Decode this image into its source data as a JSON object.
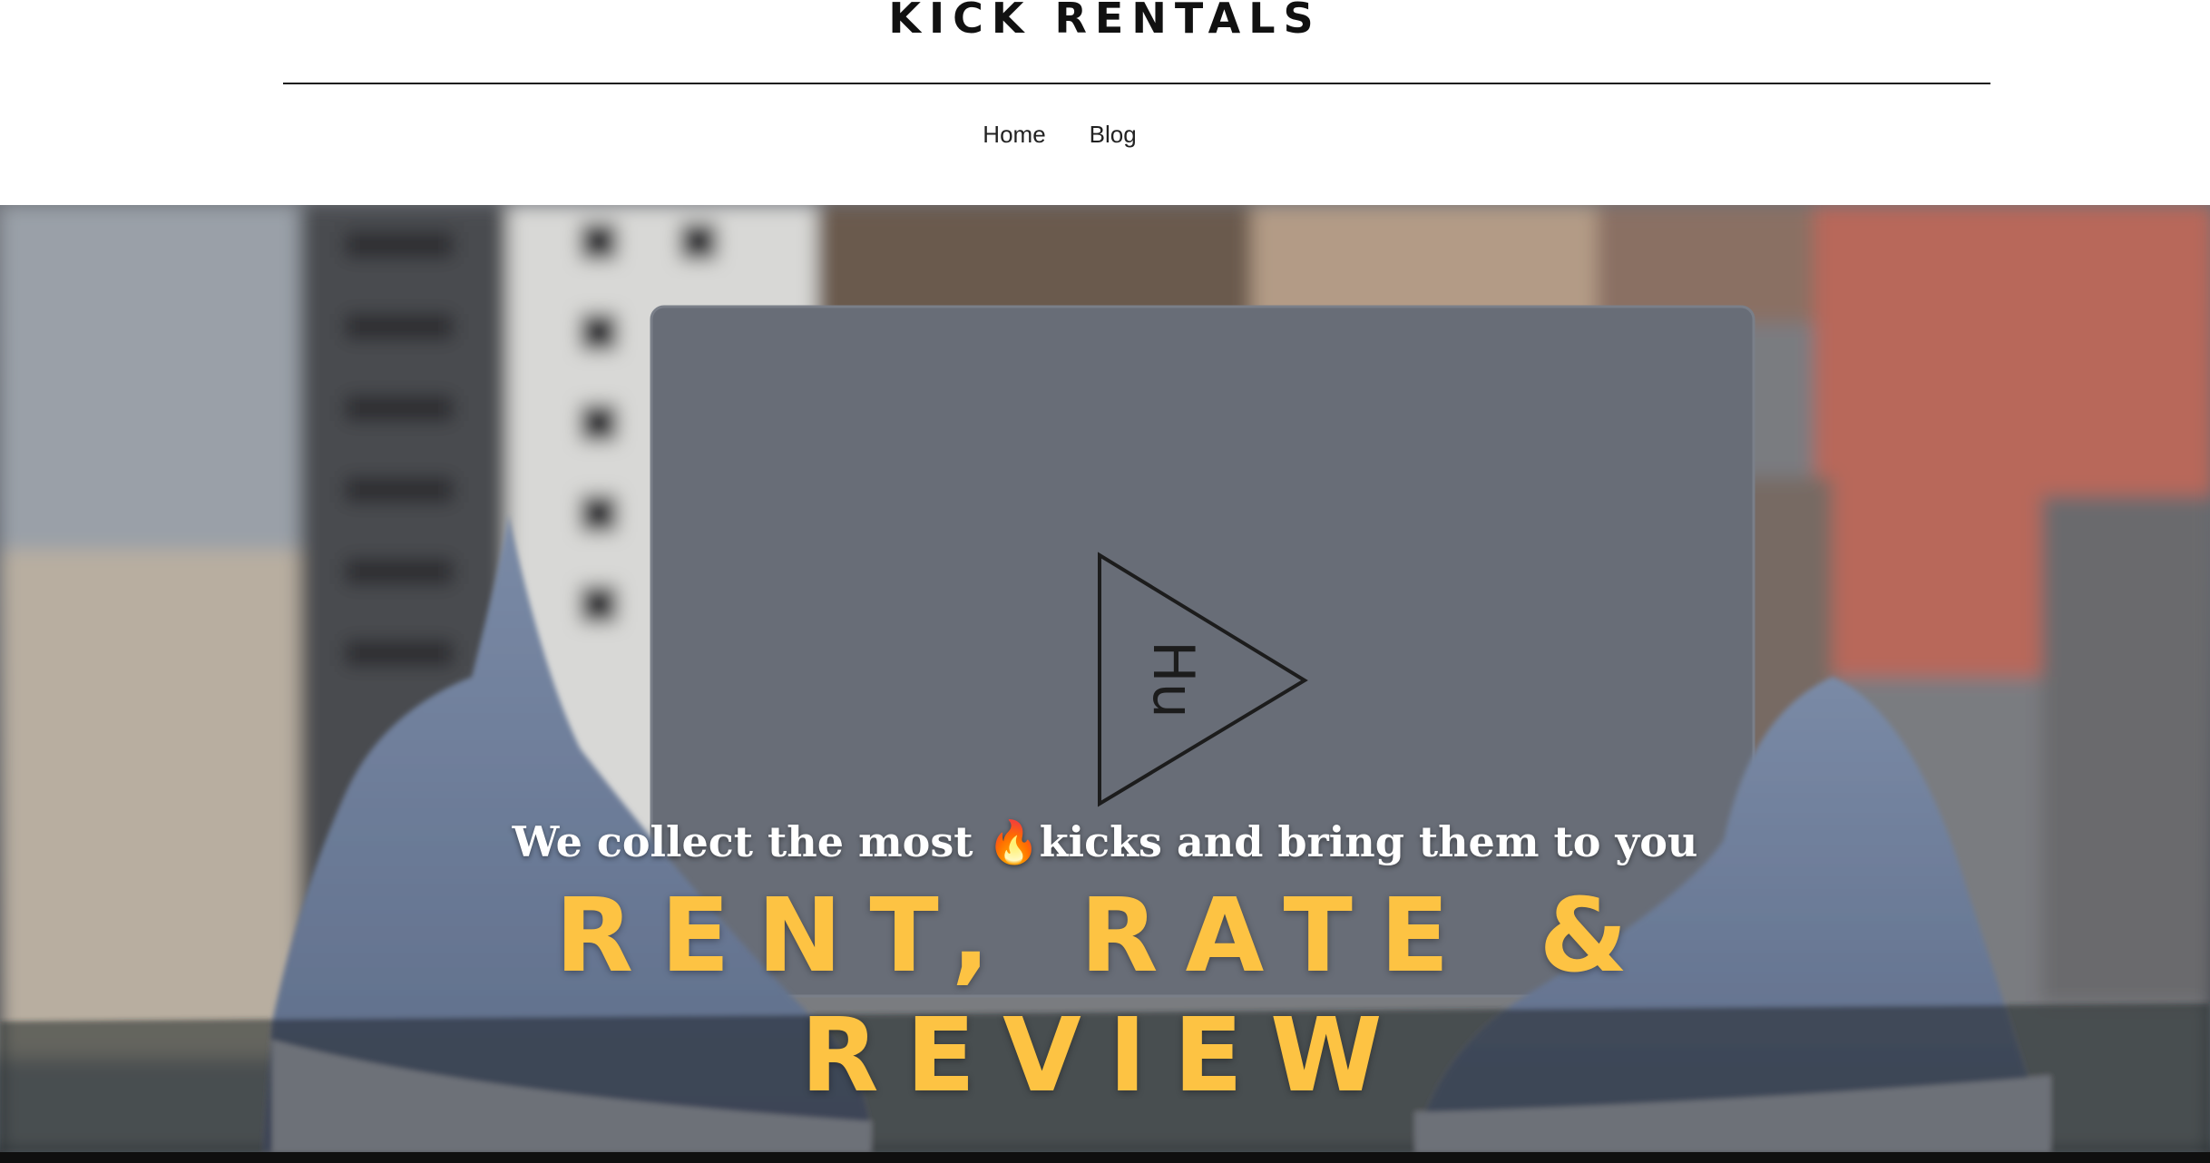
{
  "header": {
    "site_title": "KICK RENTALS",
    "nav": [
      {
        "label": "Home"
      },
      {
        "label": "Blog"
      }
    ]
  },
  "hero": {
    "tagline": "We collect the most 🔥kicks and bring them to you",
    "headline_line1": "RENT, RATE &",
    "headline_line2": "REVIEW",
    "background_image": "blurred city buildings with grey sneakers and shoe box",
    "headline_color": "#fdc343"
  }
}
